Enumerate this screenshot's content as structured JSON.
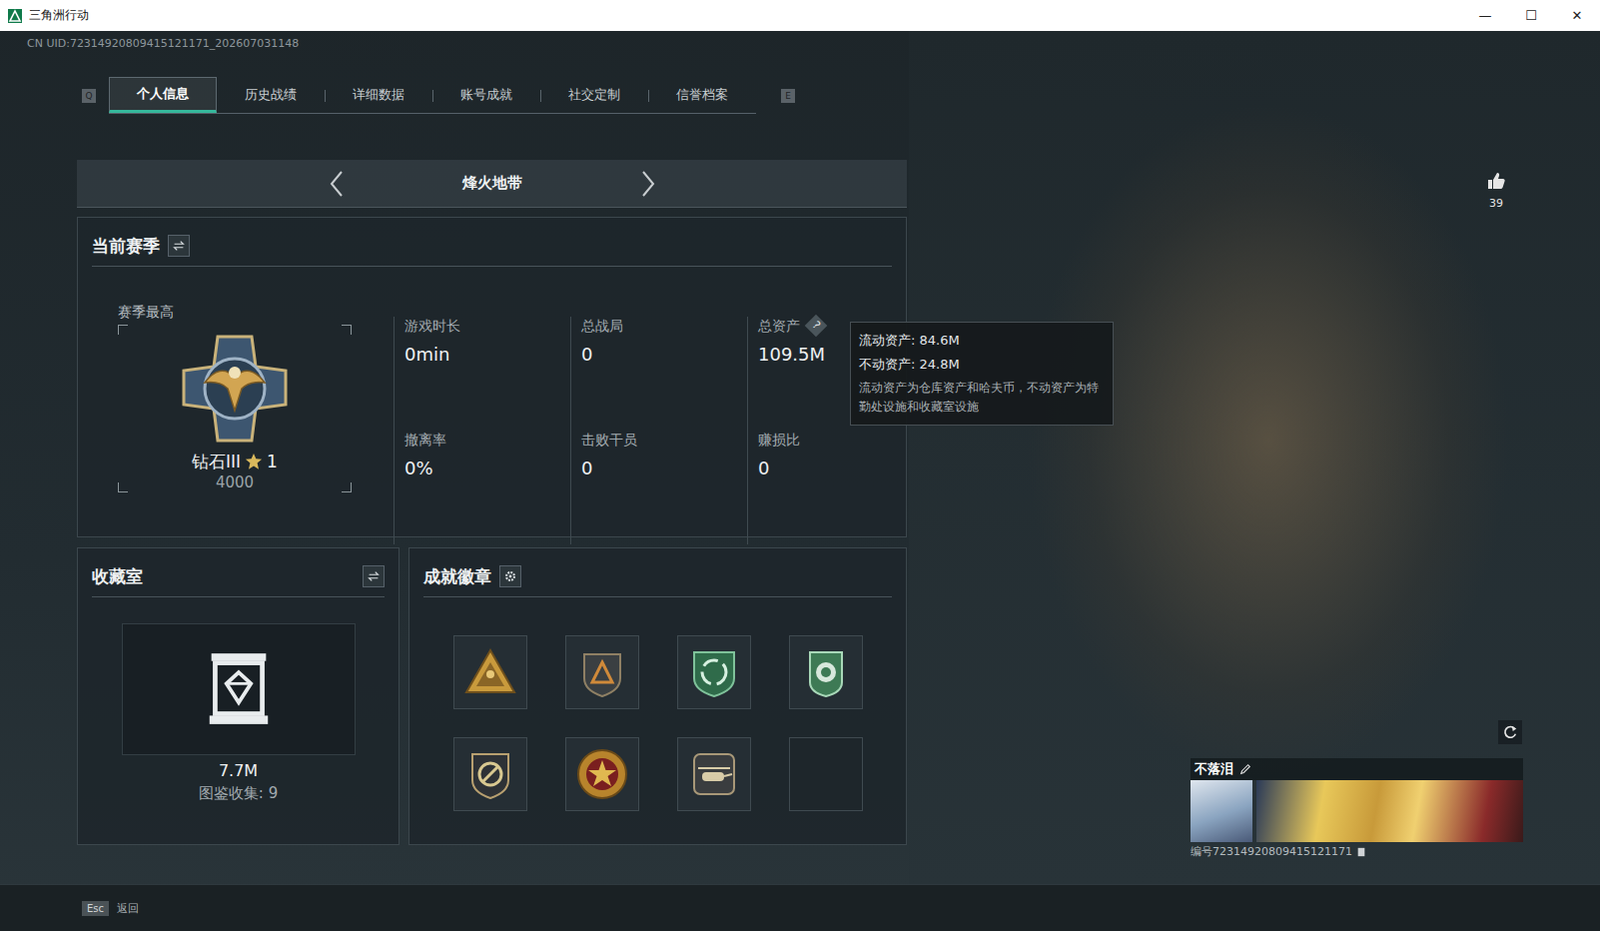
{
  "window": {
    "title": "三角洲行动",
    "controls": [
      "—",
      "☐",
      "✕"
    ]
  },
  "uid": "CN UID:72314920809415121171_202607031148",
  "tabs": {
    "prev_key": "Q",
    "next_key": "E",
    "items": [
      {
        "label": "个人信息",
        "selected": true
      },
      {
        "label": "历史战绩",
        "selected": false
      },
      {
        "label": "详细数据",
        "selected": false
      },
      {
        "label": "账号成就",
        "selected": false
      },
      {
        "label": "社交定制",
        "selected": false
      },
      {
        "label": "信誉档案",
        "selected": false
      }
    ]
  },
  "mode": {
    "label": "烽火地带"
  },
  "season": {
    "title": "当前赛季",
    "best_label": "赛季最高",
    "rank": "钻石III",
    "star_count": "1",
    "score": "4000",
    "help_icon": "?",
    "stats": [
      {
        "label": "游戏时长",
        "value": "0min",
        "kind": "plain"
      },
      {
        "label": "总战局",
        "value": "0",
        "kind": "plain"
      },
      {
        "label": "总资产",
        "value": "109.5M",
        "kind": "assets"
      },
      {
        "label": "撤离率",
        "value": "0%",
        "kind": "plain"
      },
      {
        "label": "击败干员",
        "value": "0",
        "kind": "plain"
      },
      {
        "label": "赚损比",
        "value": "0",
        "kind": "plain"
      }
    ]
  },
  "tooltip": {
    "lines": [
      "流动资产: 84.6M",
      "不动资产: 24.8M"
    ],
    "note": "流动资产为仓库资产和哈夫币，不动资产为特勤处设施和收藏室设施"
  },
  "collection": {
    "title": "收藏室",
    "value": "7.7M",
    "count_label": "图鉴收集: 9"
  },
  "achievements": {
    "title": "成就徽章",
    "badges": [
      {
        "filled": true
      },
      {
        "filled": true
      },
      {
        "filled": true
      },
      {
        "filled": true
      },
      {
        "filled": true
      },
      {
        "filled": true
      },
      {
        "filled": true
      },
      {
        "filled": false
      }
    ]
  },
  "likes": {
    "count": "39"
  },
  "player": {
    "name": "不落泪",
    "id": "编号72314920809415121171"
  },
  "footer": {
    "key": "Esc",
    "label": "返回"
  }
}
